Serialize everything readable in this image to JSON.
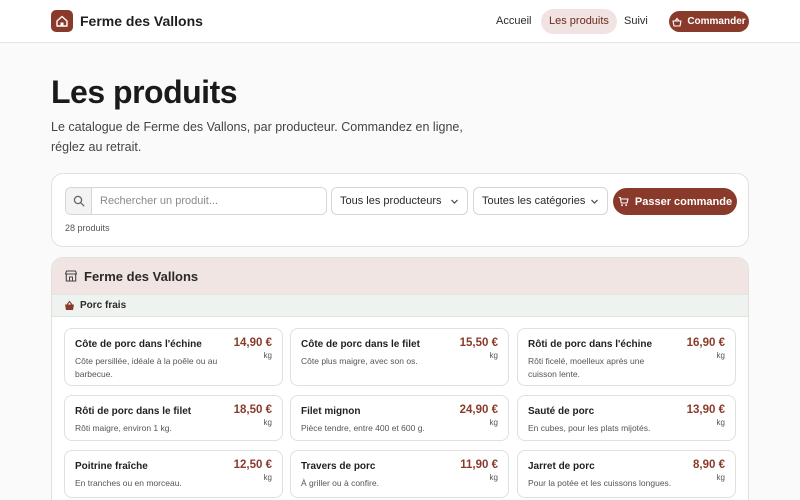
{
  "header": {
    "brand": "Ferme des Vallons",
    "nav": [
      {
        "label": "Accueil"
      },
      {
        "label": "Les produits",
        "active": true
      },
      {
        "label": "Suivi"
      }
    ],
    "cta": "Commander"
  },
  "page": {
    "title": "Les produits",
    "intro": "Le catalogue de Ferme des Vallons, par producteur. Commandez en ligne, réglez au retrait."
  },
  "filters": {
    "search_placeholder": "Rechercher un produit...",
    "producer_select": "Tous les producteurs",
    "category_select": "Toutes les catégories",
    "order_button": "Passer commande",
    "count": "28 produits"
  },
  "producer": {
    "name": "Ferme des Vallons",
    "category": "Porc frais",
    "products": [
      {
        "name": "Côte de porc dans l'échine",
        "desc": "Côte persillée, idéale à la poêle ou au barbecue.",
        "price": "14,90 €",
        "unit": "kg"
      },
      {
        "name": "Côte de porc dans le filet",
        "desc": "Côte plus maigre, avec son os.",
        "price": "15,50 €",
        "unit": "kg"
      },
      {
        "name": "Rôti de porc dans l'échine",
        "desc": "Rôti ficelé, moelleux après une cuisson lente.",
        "price": "16,90 €",
        "unit": "kg"
      },
      {
        "name": "Rôti de porc dans le filet",
        "desc": "Rôti maigre, environ 1 kg.",
        "price": "18,50 €",
        "unit": "kg"
      },
      {
        "name": "Filet mignon",
        "desc": "Pièce tendre, entre 400 et 600 g.",
        "price": "24,90 €",
        "unit": "kg"
      },
      {
        "name": "Sauté de porc",
        "desc": "En cubes, pour les plats mijotés.",
        "price": "13,90 €",
        "unit": "kg"
      },
      {
        "name": "Poitrine fraîche",
        "desc": "En tranches ou en morceau.",
        "price": "12,50 €",
        "unit": "kg"
      },
      {
        "name": "Travers de porc",
        "desc": "À griller ou à confire.",
        "price": "11,90 €",
        "unit": "kg"
      },
      {
        "name": "Jarret de porc",
        "desc": "Pour la potée et les cuissons longues.",
        "price": "8,90 €",
        "unit": "kg"
      }
    ]
  },
  "colors": {
    "accent": "#8a3a2a",
    "producer_header_bg": "#f1e5e3",
    "category_header_bg": "#eff3f0"
  }
}
